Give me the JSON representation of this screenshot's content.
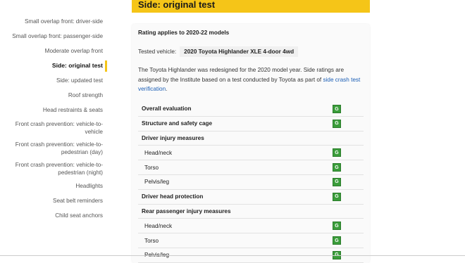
{
  "page_title": "Side: original test",
  "sidebar": {
    "items": [
      {
        "label": "Small overlap front: driver-side",
        "active": false
      },
      {
        "label": "Small overlap front: passenger-side",
        "active": false
      },
      {
        "label": "Moderate overlap front",
        "active": false
      },
      {
        "label": "Side: original test",
        "active": true
      },
      {
        "label": "Side: updated test",
        "active": false
      },
      {
        "label": "Roof strength",
        "active": false
      },
      {
        "label": "Head restraints & seats",
        "active": false
      },
      {
        "label": "Front crash prevention: vehicle-to-vehicle",
        "active": false
      },
      {
        "label": "Front crash prevention: vehicle-to-pedestrian (day)",
        "active": false
      },
      {
        "label": "Front crash prevention: vehicle-to-pedestrian (night)",
        "active": false
      },
      {
        "label": "Headlights",
        "active": false
      },
      {
        "label": "Seat belt reminders",
        "active": false
      },
      {
        "label": "Child seat anchors",
        "active": false
      }
    ]
  },
  "card": {
    "rating_applies": "Rating applies to 2020-22 models",
    "tested_label": "Tested vehicle:",
    "tested_value": "2020 Toyota Highlander XLE 4-door 4wd",
    "description_text": "The Toyota Highlander was redesigned for the 2020 model year. Side ratings are assigned by the Institute based on a test conducted by Toyota as part of ",
    "description_link": "side crash test verification",
    "description_end": "."
  },
  "ratings": [
    {
      "label": "Overall evaluation",
      "rating": "G",
      "style": "bold"
    },
    {
      "label": "Structure and safety cage",
      "rating": "G",
      "style": "bold"
    },
    {
      "label": "Driver injury measures",
      "rating": "",
      "style": "group"
    },
    {
      "label": "Head/neck",
      "rating": "G",
      "style": "sub"
    },
    {
      "label": "Torso",
      "rating": "G",
      "style": "sub"
    },
    {
      "label": "Pelvis/leg",
      "rating": "G",
      "style": "sub"
    },
    {
      "label": "Driver head protection",
      "rating": "G",
      "style": "bold"
    },
    {
      "label": "Rear passenger injury measures",
      "rating": "",
      "style": "group"
    },
    {
      "label": "Head/neck",
      "rating": "G",
      "style": "sub"
    },
    {
      "label": "Torso",
      "rating": "G",
      "style": "sub"
    },
    {
      "label": "Pelvis/leg",
      "rating": "G",
      "style": "sub"
    }
  ],
  "colors": {
    "accent": "#f5c518",
    "good": "#3a9d3a",
    "link": "#1a5db5"
  }
}
